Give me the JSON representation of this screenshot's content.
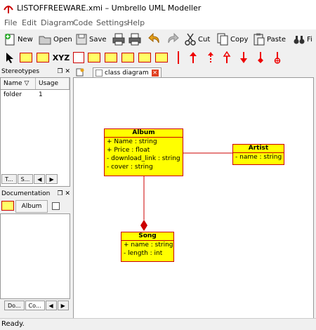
{
  "window": {
    "title": "LISTOFFREEWARE.xmi – Umbrello UML Modeller"
  },
  "menu": [
    "File",
    "Edit",
    "Diagram",
    "Code",
    "Settings",
    "Help"
  ],
  "toolbar": {
    "new": "New",
    "open": "Open",
    "save": "Save",
    "cut": "Cut",
    "copy": "Copy",
    "paste": "Paste",
    "find": "Fi"
  },
  "tool_labels": {
    "xyz": "XYZ"
  },
  "stereotypes": {
    "title": "Stereotypes",
    "columns": [
      "Name",
      "Usage"
    ],
    "rows": [
      {
        "name": "folder",
        "usage": "1"
      }
    ],
    "tabs": [
      "T...",
      "S..."
    ]
  },
  "documentation": {
    "title": "Documentation",
    "item": "Album",
    "tabs": [
      "Do...",
      "Co..."
    ]
  },
  "diagram": {
    "tab": "class diagram",
    "classes": [
      {
        "name": "Album",
        "attributes": [
          "+ Name : string",
          "+ Price : float",
          "- download_link : string",
          "- cover : string"
        ]
      },
      {
        "name": "Artist",
        "attributes": [
          "- name : string"
        ]
      },
      {
        "name": "Song",
        "attributes": [
          "+ name : string",
          "- length : int"
        ]
      }
    ]
  },
  "status": "Ready.",
  "colors": {
    "class_fill": "#ffff00",
    "class_border": "#cc0000",
    "association": "#cc0000"
  }
}
